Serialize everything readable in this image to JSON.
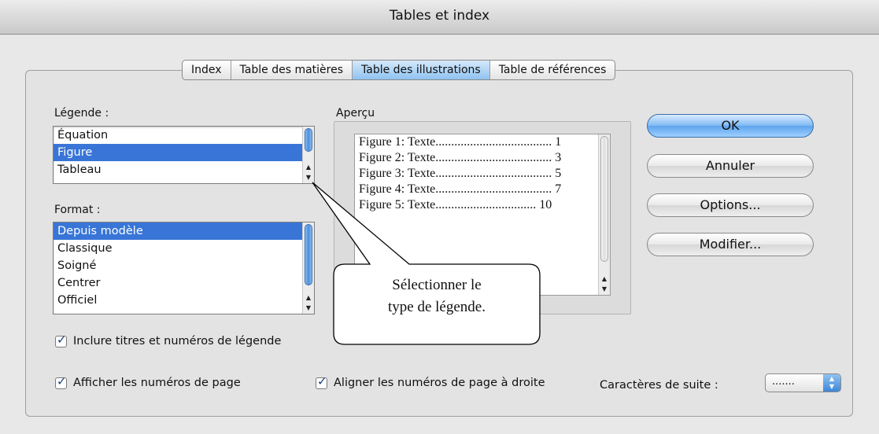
{
  "window": {
    "title": "Tables et index"
  },
  "tabs": [
    {
      "label": "Index",
      "active": false
    },
    {
      "label": "Table des matières",
      "active": false
    },
    {
      "label": "Table des illustrations",
      "active": true
    },
    {
      "label": "Table de références",
      "active": false
    }
  ],
  "legende": {
    "label": "Légende :",
    "items": [
      "Équation",
      "Figure",
      "Tableau"
    ],
    "selected": "Figure"
  },
  "format": {
    "label": "Format :",
    "items": [
      "Depuis modèle",
      "Classique",
      "Soigné",
      "Centrer",
      "Officiel"
    ],
    "selected": "Depuis modèle"
  },
  "apercu": {
    "label": "Aperçu",
    "lines": [
      "Figure 1: Texte..................................... 1",
      "Figure 2: Texte..................................... 3",
      "Figure 3: Texte..................................... 5",
      "Figure 4: Texte..................................... 7",
      "Figure 5: Texte................................ 10"
    ]
  },
  "buttons": {
    "ok": "OK",
    "cancel": "Annuler",
    "options": "Options...",
    "modify": "Modifier..."
  },
  "checkboxes": {
    "inclure": {
      "label": "Inclure titres et numéros de légende",
      "checked": true
    },
    "afficher": {
      "label": "Afficher les numéros de page",
      "checked": true
    },
    "aligner": {
      "label": "Aligner les numéros de page à droite",
      "checked": true
    }
  },
  "suite": {
    "label": "Caractères de suite :",
    "value": "......."
  },
  "callout": {
    "line1": "Sélectionner le",
    "line2": "type de légende."
  },
  "colors": {
    "selection": "#3875d7",
    "accent": "#5ea4ee"
  }
}
